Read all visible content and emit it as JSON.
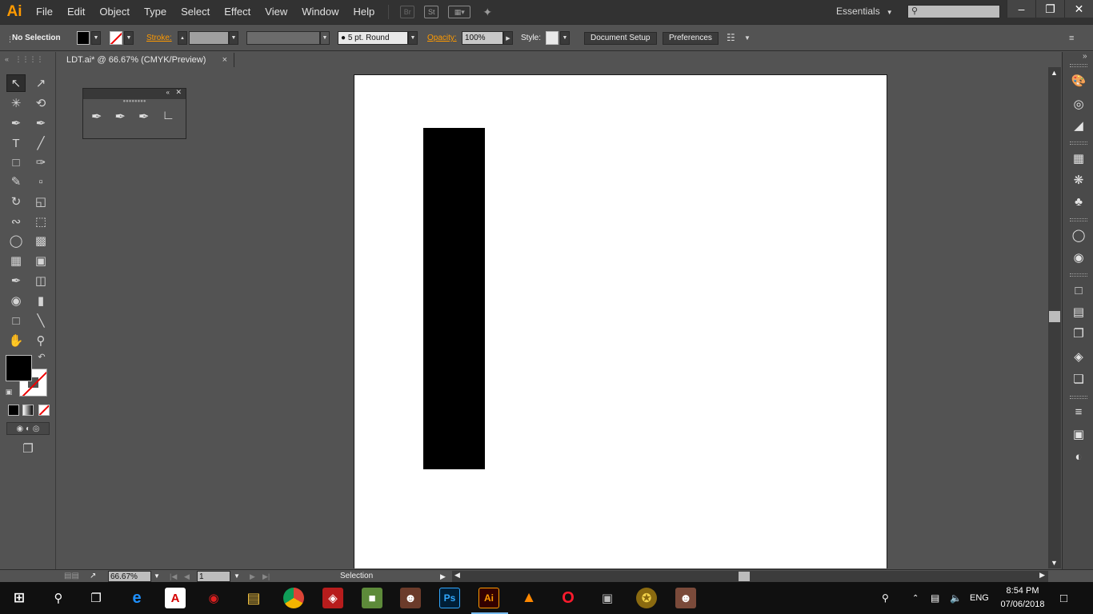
{
  "app": {
    "logo_text": "Ai",
    "accent_color": "#FF9A00"
  },
  "menubar": {
    "items": [
      "File",
      "Edit",
      "Object",
      "Type",
      "Select",
      "Effect",
      "View",
      "Window",
      "Help"
    ],
    "bridge_label": "Br",
    "stock_label": "St",
    "workspace": "Essentials",
    "search_placeholder": "",
    "window_controls": {
      "minimize": "minimize-icon",
      "restore": "restore-icon",
      "close": "close-icon"
    }
  },
  "control": {
    "selection_label": "No Selection",
    "fill_color": "#000000",
    "stroke_label": "Stroke:",
    "stroke_weight": "",
    "variable_width": "",
    "brush": "5 pt. Round",
    "opacity_label": "Opacity:",
    "opacity_value": "100%",
    "style_label": "Style:",
    "document_setup": "Document Setup",
    "preferences": "Preferences"
  },
  "document": {
    "tab_title": "LDT.ai* @ 66.67% (CMYK/Preview)",
    "close_glyph": "×",
    "artboard_color": "#FFFFFF",
    "shape_color": "#000000"
  },
  "pen_panel": {
    "tools": [
      "pen-tool",
      "add-anchor-point-tool",
      "delete-anchor-point-tool",
      "anchor-point-tool"
    ]
  },
  "tools": {
    "fill_color": "#000000",
    "stroke_color": "none"
  },
  "status": {
    "zoom": "66.67%",
    "artboard_number": "1",
    "current_tool": "Selection"
  },
  "taskbar": {
    "apps": [
      "start",
      "search",
      "task-view",
      "edge",
      "acrobat",
      "screen-recorder",
      "file-explorer",
      "chrome",
      "dota2",
      "minecraft",
      "game",
      "photoshop",
      "illustrator",
      "vlc",
      "opera",
      "game-tank",
      "game-gold",
      "game-character"
    ],
    "illustrator_label": "Ai",
    "photoshop_label": "Ps",
    "language": "ENG",
    "time": "8:54 PM",
    "date": "07/06/2018"
  }
}
